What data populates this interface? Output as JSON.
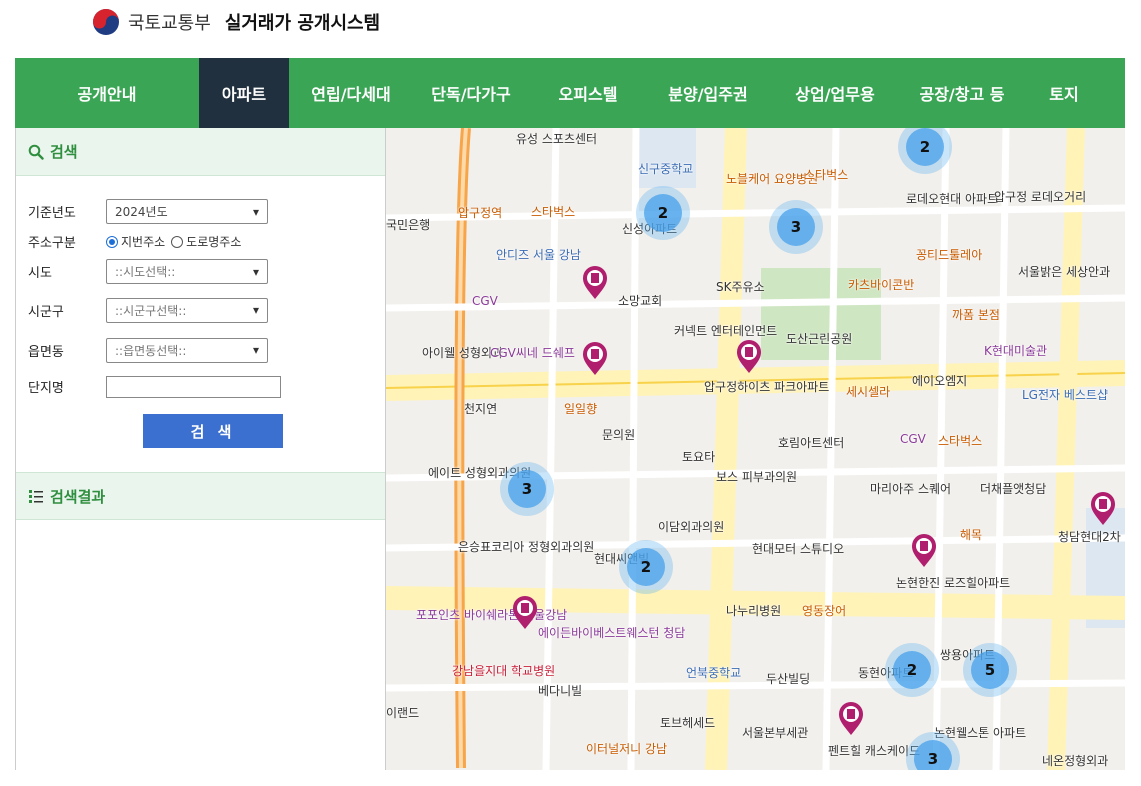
{
  "header": {
    "org_name": "국토교통부",
    "system_name": "실거래가 공개시스템"
  },
  "nav": {
    "items": [
      "공개안내",
      "아파트",
      "연립/다세대",
      "단독/다가구",
      "오피스텔",
      "분양/입주권",
      "상업/업무용",
      "공장/창고 등",
      "토지"
    ],
    "active": "아파트"
  },
  "search": {
    "title": "검색",
    "year_label": "기준년도",
    "year_value": "2024년도",
    "addr_type_label": "주소구분",
    "addr_opt1": "지번주소",
    "addr_opt2": "도로명주소",
    "sido_label": "시도",
    "sido_value": "::시도선택::",
    "sigungu_label": "시군구",
    "sigungu_value": "::시군구선택::",
    "eup_label": "읍면동",
    "eup_value": "::읍면동선택::",
    "complex_label": "단지명",
    "complex_value": "",
    "button": "검 색"
  },
  "results": {
    "title": "검색결과"
  },
  "map": {
    "clusters": [
      "2",
      "2",
      "3",
      "3",
      "2",
      "2",
      "5",
      "3"
    ],
    "labels": [
      "유성 스포츠센터",
      "신구중학교",
      "노블케어 요양병원",
      "스타벅스",
      "로데오현대 아파트",
      "압구정 로데오거리",
      "스타벅스",
      "신성아파트",
      "국민은행",
      "압구정역",
      "스타벅스",
      "안디즈 서울 강남",
      "소망교회",
      "SK주유소",
      "도산근린공원",
      "꽁티드툴레아",
      "서울밝은 세상안과",
      "카츠바이콘반",
      "까폼 본점",
      "K현대미술관",
      "CGV",
      "아이웰 성형외과",
      "CGV씨네 드쉐프",
      "커넥트 엔터테인먼트",
      "압구정하이츠 파크아파트",
      "세시셀라",
      "에이오엠지",
      "LG전자 베스트샵",
      "천지연",
      "일일향",
      "문의원",
      "호림아트센터",
      "CGV",
      "스타벅스",
      "토요타",
      "에이트 성형외과의원",
      "보스 피부과의원",
      "마리아주 스퀘어",
      "더채플앳청담",
      "청담현대2차 아파트",
      "이담외과의원",
      "은승표코리아 정형외과의원",
      "현대씨앤빌",
      "현대모터 스튜디오",
      "해목",
      "논현한진 로즈힐아파트",
      "포포인츠 바이쉐라톤 서울강남",
      "에이든바이베스트웨스턴 청담",
      "나누리병원",
      "영동장어",
      "쌍용아파트",
      "강남을지대 학교병원",
      "언북중학교",
      "두산빌딩",
      "동현아파트",
      "베다니빌",
      "토브헤세드",
      "서울본부세관",
      "논현웰스톤 아파트",
      "펜트힐 캐스케이드",
      "이터널저니 강남",
      "네온정형외과",
      "이랜드"
    ]
  }
}
